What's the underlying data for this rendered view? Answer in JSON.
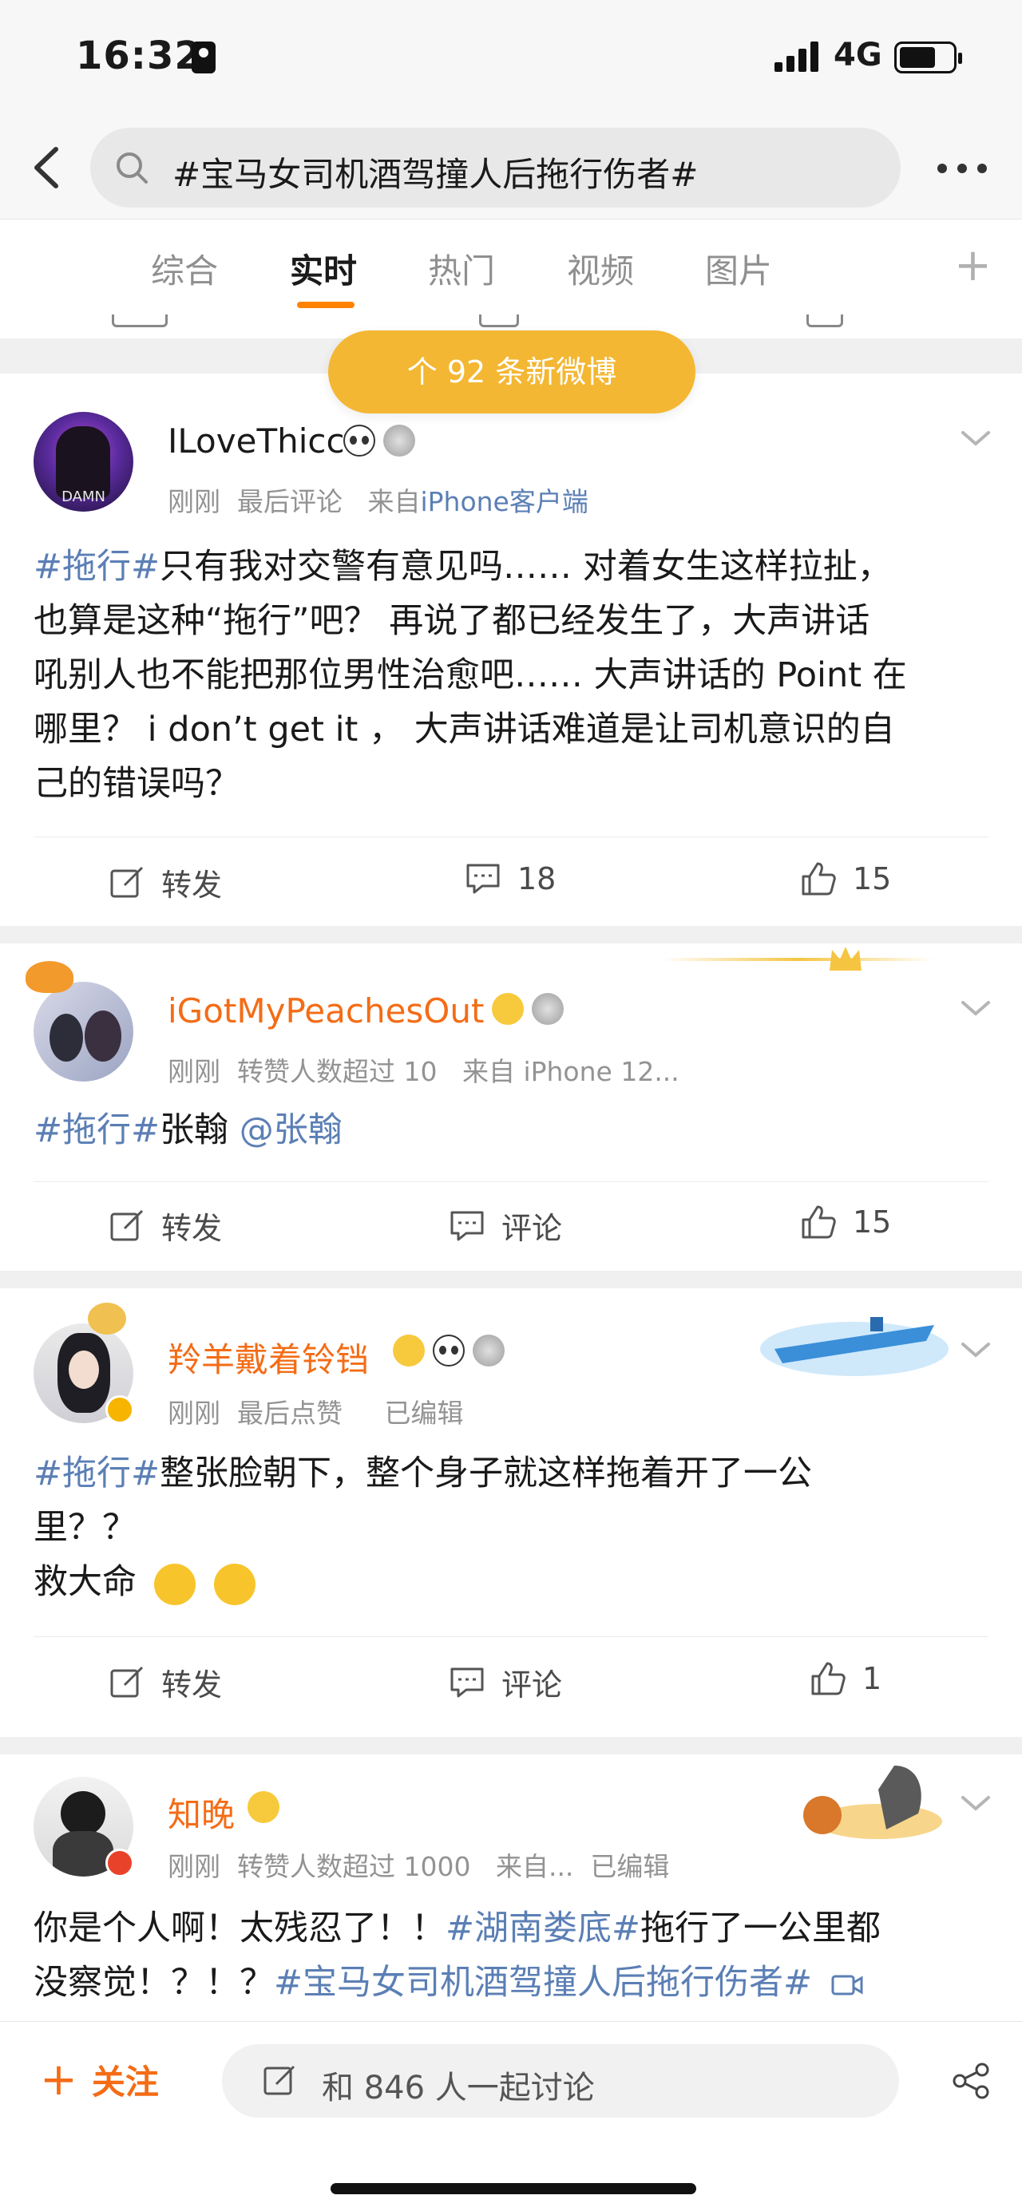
{
  "status_bar": {
    "time": "16:32",
    "network": "4G"
  },
  "search": {
    "query": "#宝马女司机酒驾撞人后拖行伤者#"
  },
  "tabs": [
    {
      "label": "综合",
      "active": false
    },
    {
      "label": "实时",
      "active": true
    },
    {
      "label": "热门",
      "active": false
    },
    {
      "label": "视频",
      "active": false
    },
    {
      "label": "图片",
      "active": false
    }
  ],
  "new_posts_pill": "个 92 条新微博",
  "posts": [
    {
      "username": "ILoveThicc",
      "avatar_text": "DAMN",
      "meta_time": "刚刚",
      "meta_note": "最后评论",
      "meta_from": "来自",
      "meta_source": "iPhone客户端",
      "tag": "#拖行#",
      "content_lines": [
        "只有我对交警有意见吗……  对着女生这样拉扯，",
        "也算是这种“拖行”吧？  再说了都已经发生了，大声讲话",
        "吼别人也不能把那位男性治愈吧…… 大声讲话的 Point 在",
        "哪里？  i don’t get it ，  大声讲话难道是让司机意识的自",
        "己的错误吗？"
      ],
      "repost_label": "转发",
      "comment_count": "18",
      "like_count": "15"
    },
    {
      "username": "iGotMyPeachesOut",
      "meta_time": "刚刚",
      "meta_note": "转赞人数超过 10",
      "meta_from": "来自 iPhone 12...",
      "tag": "#拖行#",
      "text": "张翰 ",
      "mention": "@张翰",
      "repost_label": "转发",
      "comment_label": "评论",
      "like_count": "15"
    },
    {
      "username": "羚羊戴着铃铛",
      "meta_time": "刚刚",
      "meta_note": "最后点赞",
      "meta_edit": "已编辑",
      "tag": "#拖行#",
      "content_line1": "整张脸朝下，整个身子就这样拖着开了一公",
      "content_line2": "里？？",
      "content_line3": "救大命",
      "repost_label": "转发",
      "comment_label": "评论",
      "like_count": "1"
    },
    {
      "username": "知晚",
      "meta_time": "刚刚",
      "meta_note": "转赞人数超过 1000",
      "meta_from": "来自...",
      "meta_edit": "已编辑",
      "text1": "你是个人啊！太残忍了！！",
      "tag1": "#湖南娄底#",
      "text2": "拖行了一公里都",
      "text3": "没察觉！？！？",
      "tag2": "#宝马女司机酒驾撞人后拖行伤者#"
    }
  ],
  "bottom_bar": {
    "follow_label": "关注",
    "discuss_label": "和 846 人一起讨论"
  },
  "colors": {
    "accent": "#ff8200",
    "link": "#5b7fb5",
    "vip_name": "#f46c16",
    "pill": "#f3b733"
  }
}
